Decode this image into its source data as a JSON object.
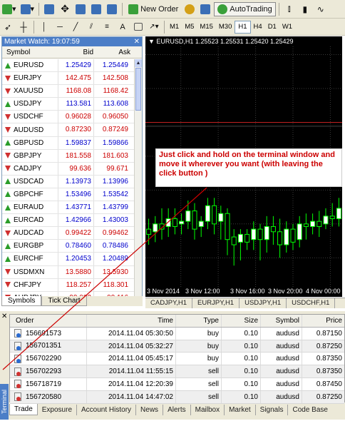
{
  "toolbar": {
    "new_order_label": "New Order",
    "autotrading_label": "AutoTrading",
    "timeframes": [
      "M1",
      "M5",
      "M15",
      "M30",
      "H1",
      "H4",
      "D1",
      "W1"
    ],
    "active_timeframe": "H1"
  },
  "market_watch": {
    "title": "Market Watch: 19:07:59",
    "columns": {
      "symbol": "Symbol",
      "bid": "Bid",
      "ask": "Ask"
    },
    "rows": [
      {
        "symbol": "EURUSD",
        "bid": "1.25429",
        "ask": "1.25449",
        "dir": "up"
      },
      {
        "symbol": "EURJPY",
        "bid": "142.475",
        "ask": "142.508",
        "dir": "down"
      },
      {
        "symbol": "XAUUSD",
        "bid": "1168.08",
        "ask": "1168.42",
        "dir": "down"
      },
      {
        "symbol": "USDJPY",
        "bid": "113.581",
        "ask": "113.608",
        "dir": "up"
      },
      {
        "symbol": "USDCHF",
        "bid": "0.96028",
        "ask": "0.96050",
        "dir": "down"
      },
      {
        "symbol": "AUDUSD",
        "bid": "0.87230",
        "ask": "0.87249",
        "dir": "down"
      },
      {
        "symbol": "GBPUSD",
        "bid": "1.59837",
        "ask": "1.59866",
        "dir": "up"
      },
      {
        "symbol": "GBPJPY",
        "bid": "181.558",
        "ask": "181.603",
        "dir": "down"
      },
      {
        "symbol": "CADJPY",
        "bid": "99.636",
        "ask": "99.671",
        "dir": "down"
      },
      {
        "symbol": "USDCAD",
        "bid": "1.13973",
        "ask": "1.13996",
        "dir": "up"
      },
      {
        "symbol": "GBPCHF",
        "bid": "1.53496",
        "ask": "1.53542",
        "dir": "up"
      },
      {
        "symbol": "EURAUD",
        "bid": "1.43771",
        "ask": "1.43799",
        "dir": "up"
      },
      {
        "symbol": "EURCAD",
        "bid": "1.42966",
        "ask": "1.43003",
        "dir": "up"
      },
      {
        "symbol": "AUDCAD",
        "bid": "0.99422",
        "ask": "0.99462",
        "dir": "down"
      },
      {
        "symbol": "EURGBP",
        "bid": "0.78460",
        "ask": "0.78486",
        "dir": "up"
      },
      {
        "symbol": "EURCHF",
        "bid": "1.20453",
        "ask": "1.20489",
        "dir": "up"
      },
      {
        "symbol": "USDMXN",
        "bid": "13.5880",
        "ask": "13.5930",
        "dir": "down"
      },
      {
        "symbol": "CHFJPY",
        "bid": "118.257",
        "ask": "118.301",
        "dir": "down"
      },
      {
        "symbol": "AUDJPY",
        "bid": "99.082",
        "ask": "99.116",
        "dir": "down"
      }
    ],
    "tabs": [
      "Symbols",
      "Tick Chart"
    ]
  },
  "chart": {
    "info": "EURUSD,H1  1.25523 1.25531 1.25420 1.25429",
    "time_labels": [
      "3 Nov 2014",
      "3 Nov 12:00",
      "3 Nov 16:00",
      "3 Nov 20:00",
      "4 Nov 00:00"
    ],
    "callout": "Just click and hold on the terminal window and move it wherever you want (with leaving the click button )",
    "tabs": [
      "CADJPY,H1",
      "EURJPY,H1",
      "USDJPY,H1",
      "USDCHF,H1"
    ]
  },
  "terminal": {
    "label": "Terminal",
    "columns": {
      "order": "Order",
      "time": "Time",
      "type": "Type",
      "size": "Size",
      "symbol": "Symbol",
      "price": "Price"
    },
    "rows": [
      {
        "order": "156691573",
        "time": "2014.11.04 05:30:50",
        "type": "buy",
        "size": "0.10",
        "symbol": "audusd",
        "price": "0.87150"
      },
      {
        "order": "156701351",
        "time": "2014.11.04 05:32:27",
        "type": "buy",
        "size": "0.10",
        "symbol": "audusd",
        "price": "0.87250"
      },
      {
        "order": "156702290",
        "time": "2014.11.04 05:45:17",
        "type": "buy",
        "size": "0.10",
        "symbol": "audusd",
        "price": "0.87350"
      },
      {
        "order": "156702293",
        "time": "2014.11.04 11:55:15",
        "type": "sell",
        "size": "0.10",
        "symbol": "audusd",
        "price": "0.87350"
      },
      {
        "order": "156718719",
        "time": "2014.11.04 12:20:39",
        "type": "sell",
        "size": "0.10",
        "symbol": "audusd",
        "price": "0.87450"
      },
      {
        "order": "156720580",
        "time": "2014.11.04 14:47:02",
        "type": "sell",
        "size": "0.10",
        "symbol": "audusd",
        "price": "0.87250"
      }
    ],
    "tabs": [
      "Trade",
      "Exposure",
      "Account History",
      "News",
      "Alerts",
      "Mailbox",
      "Market",
      "Signals",
      "Code Base"
    ]
  },
  "colors": {
    "bull": "#ffffff",
    "bear": "#000000",
    "candle_outline": "#00ff00",
    "grid": "#3a3a3a",
    "level": "#c02020",
    "annotation_arrow": "#cc0000"
  }
}
